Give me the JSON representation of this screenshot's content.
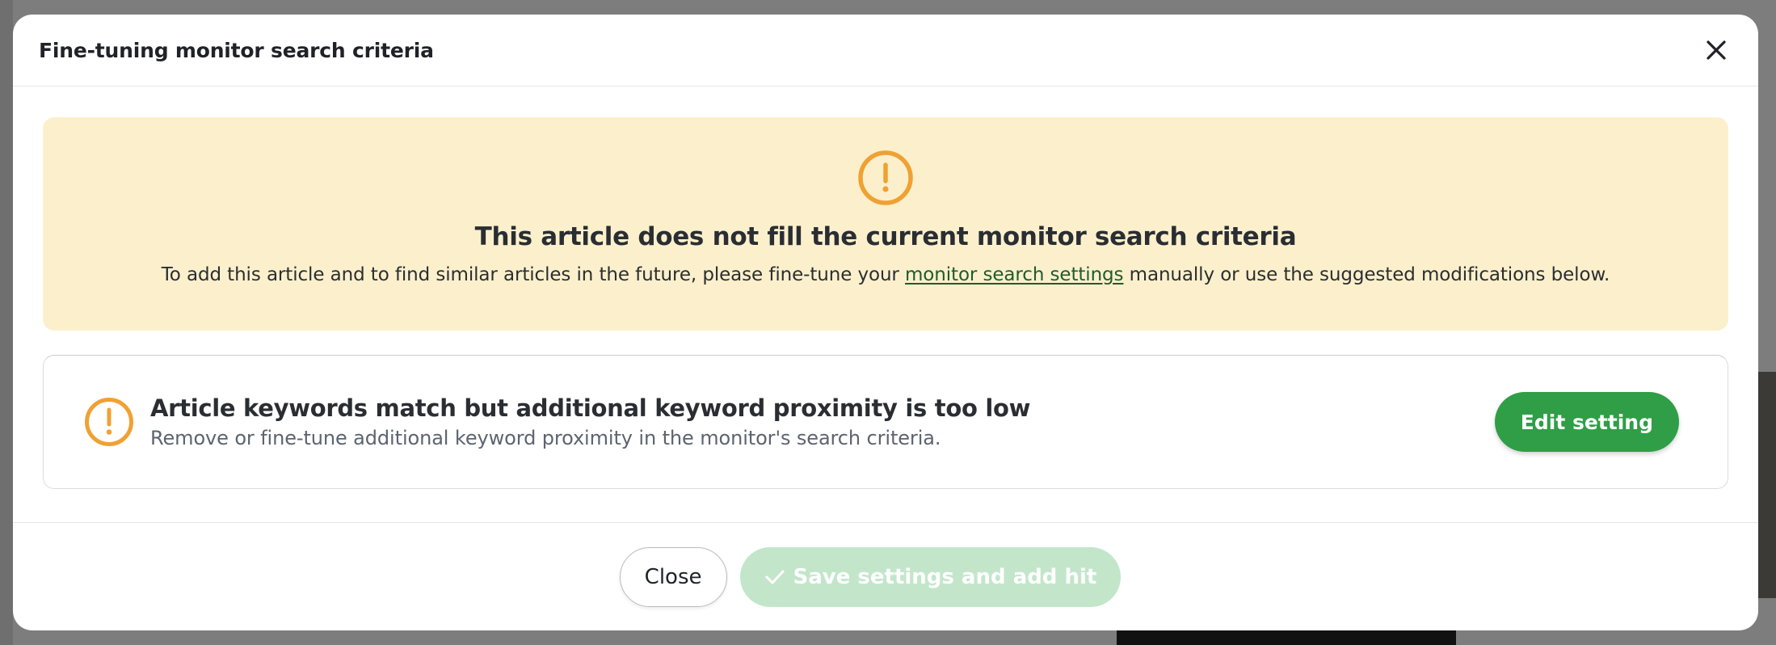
{
  "dialog": {
    "title": "Fine-tuning monitor search criteria"
  },
  "banner": {
    "icon": "exclamation-circle-icon",
    "icon_color": "#f0a133",
    "background": "#fcf0cc",
    "title": "This article does not fill the current monitor search criteria",
    "desc_before": "To add this article and to find similar articles in the future, please fine-tune your ",
    "desc_link": "monitor search settings",
    "desc_after": " manually or use the suggested modifications below."
  },
  "issue": {
    "icon": "exclamation-circle-icon",
    "title": "Article keywords match but additional keyword proximity is too low",
    "subtitle": "Remove or fine-tune additional keyword proximity in the monitor's search criteria.",
    "action_label": "Edit setting"
  },
  "footer": {
    "close_label": "Close",
    "save_label": "Save settings and add hit",
    "save_icon": "check-icon"
  },
  "colors": {
    "accent_green": "#2f9e47",
    "disabled_green": "#c3e6cb",
    "warning_orange": "#f0a133"
  }
}
